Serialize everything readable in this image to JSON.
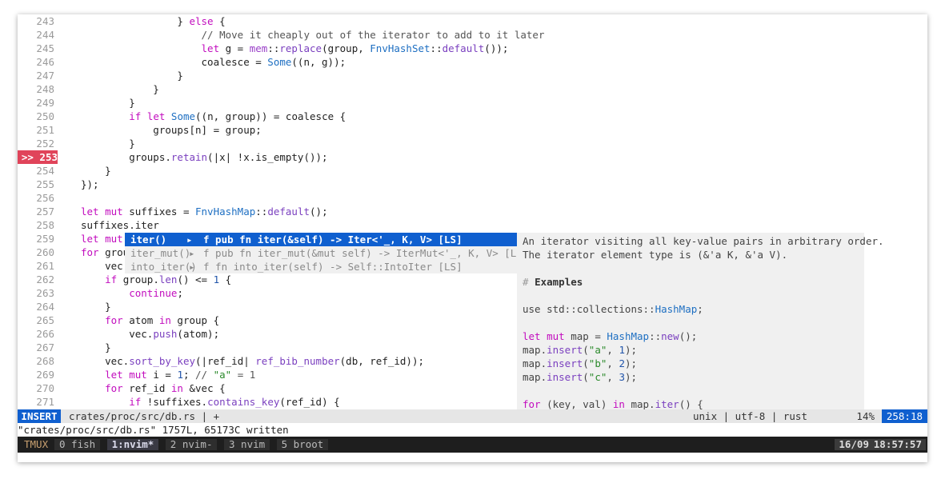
{
  "editor": {
    "lines": [
      {
        "n": "243",
        "code": "                } else {",
        "ind": 0
      },
      {
        "n": "244",
        "code": "                    // Move it cheaply out of the iterator to add to it later",
        "ind": 0
      },
      {
        "n": "245",
        "code": "                    let g = mem::replace(group, FnvHashSet::default());",
        "ind": 0
      },
      {
        "n": "246",
        "code": "                    coalesce = Some((n, g));",
        "ind": 0
      },
      {
        "n": "247",
        "code": "                }",
        "ind": 0
      },
      {
        "n": "248",
        "code": "            }",
        "ind": 0
      },
      {
        "n": "249",
        "code": "        }",
        "ind": 0
      },
      {
        "n": "250",
        "code": "        if let Some((n, group)) = coalesce {",
        "ind": 0
      },
      {
        "n": "251",
        "code": "            groups[n] = group;",
        "ind": 0
      },
      {
        "n": "252",
        "code": "        }",
        "ind": 0
      },
      {
        "n": ">> 253",
        "code": "        groups.retain(|x| !x.is_empty());",
        "ind": 0,
        "err": true
      },
      {
        "n": "254",
        "code": "    }",
        "ind": 0
      },
      {
        "n": "255",
        "code": "});",
        "ind": 0
      },
      {
        "n": "256",
        "code": "",
        "ind": 0
      },
      {
        "n": "257",
        "code": "let mut suffixes = FnvHashMap::default();",
        "ind": 0
      },
      {
        "n": "258",
        "code": "suffixes.iter",
        "ind": 0
      },
      {
        "n": "259",
        "code": "let mut",
        "ind": 0
      },
      {
        "n": "260",
        "code": "for grou",
        "ind": 0
      },
      {
        "n": "261",
        "code": "    vec.",
        "ind": 0
      },
      {
        "n": "262",
        "code": "    if group.len() <= 1 {",
        "ind": 0
      },
      {
        "n": "263",
        "code": "        continue;",
        "ind": 0
      },
      {
        "n": "264",
        "code": "    }",
        "ind": 0
      },
      {
        "n": "265",
        "code": "    for atom in group {",
        "ind": 0
      },
      {
        "n": "266",
        "code": "        vec.push(atom);",
        "ind": 0
      },
      {
        "n": "267",
        "code": "    }",
        "ind": 0
      },
      {
        "n": "268",
        "code": "    vec.sort_by_key(|ref_id| ref_bib_number(db, ref_id));",
        "ind": 0
      },
      {
        "n": "269",
        "code": "    let mut i = 1; // \"a\" = 1",
        "ind": 0
      },
      {
        "n": "270",
        "code": "    for ref_id in &vec {",
        "ind": 0
      },
      {
        "n": "271",
        "code": "        if !suffixes.contains_key(ref_id) {",
        "ind": 0
      }
    ]
  },
  "popup": {
    "items": [
      {
        "word": "iter()",
        "arrow": "▸",
        "detail": "f pub fn iter(&self) -> Iter<'_, K, V> [LS]",
        "selected": true
      },
      {
        "word": "iter_mut()",
        "arrow": "▸",
        "detail": "f pub fn iter_mut(&mut self) -> IterMut<'_, K, V> [LS]",
        "selected": false
      },
      {
        "word": "into_iter()",
        "arrow": "▸",
        "detail": "f fn into_iter(self) -> Self::IntoIter [LS]",
        "selected": false
      }
    ]
  },
  "docs": {
    "lines": [
      "An iterator visiting all key-value pairs in arbitrary order.",
      "The iterator element type is (&'a K, &'a V).",
      "",
      "# Examples",
      "",
      "use std::collections::HashMap;",
      "",
      "let mut map = HashMap::new();",
      "map.insert(\"a\", 1);",
      "map.insert(\"b\", 2);",
      "map.insert(\"c\", 3);",
      "",
      "for (key, val) in map.iter() {"
    ]
  },
  "status": {
    "mode": "INSERT",
    "file": "crates/proc/src/db.rs | +",
    "fileinfo": "unix | utf-8 | rust",
    "percent": "14%",
    "position": "258:18"
  },
  "message": "\"crates/proc/src/db.rs\" 1757L, 65173C written",
  "tmux": {
    "label": "TMUX",
    "windows": [
      {
        "label": "0 fish",
        "current": false
      },
      {
        "label": "1:nvim*",
        "current": true
      },
      {
        "label": "2 nvim-",
        "current": false
      },
      {
        "label": "3 nvim",
        "current": false
      },
      {
        "label": "5 broot",
        "current": false
      }
    ],
    "date": "16/09",
    "time": "18:57:57"
  }
}
